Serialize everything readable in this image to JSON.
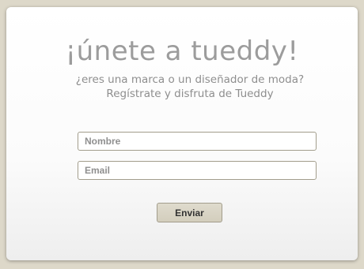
{
  "signup": {
    "title": "¡únete a tueddy!",
    "subtitle_line1": "¿eres una marca o un diseñador de moda?",
    "subtitle_line2": "Regístrate y disfruta de Tueddy",
    "name_placeholder": "Nombre",
    "email_placeholder": "Email",
    "submit_label": "Enviar"
  },
  "colors": {
    "page_background": "#ddd8c9",
    "title_text": "#9c9c9c",
    "button_background": "#d8d3c3",
    "field_border": "#a29d8c"
  }
}
